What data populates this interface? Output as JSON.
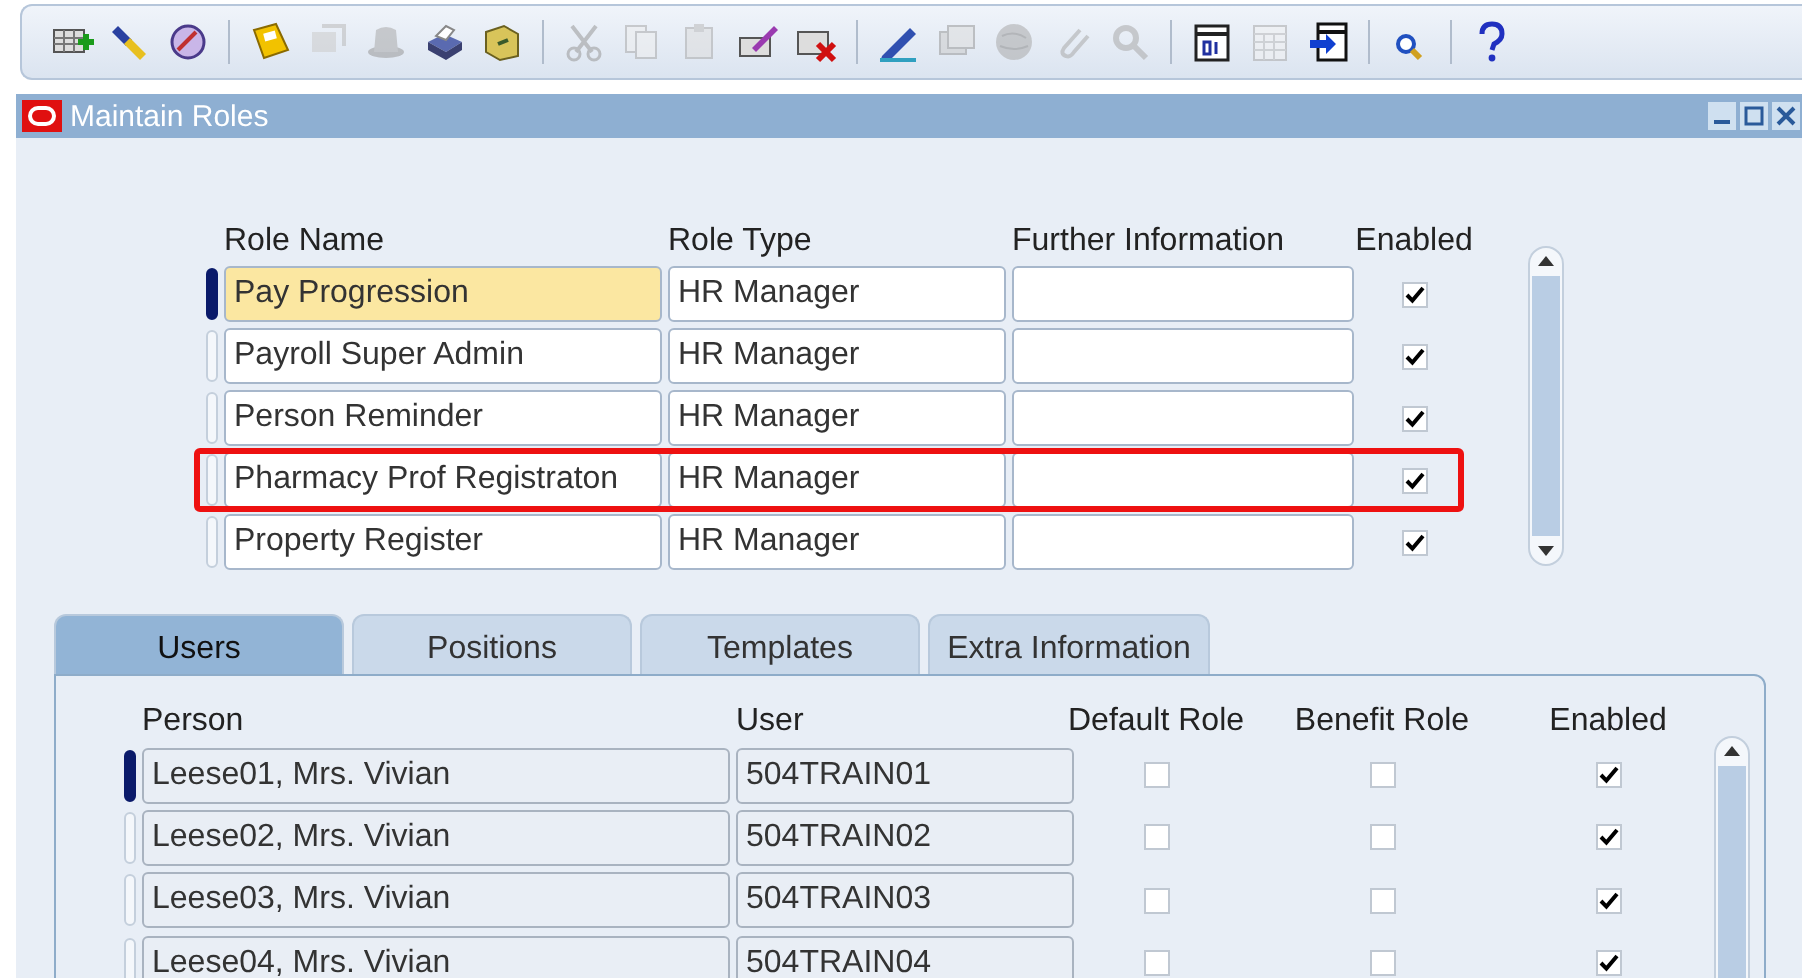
{
  "toolbar": [
    [
      {
        "kind": "new",
        "disabled": false
      },
      {
        "kind": "flashlight",
        "disabled": false
      },
      {
        "kind": "navigator",
        "disabled": false
      }
    ],
    [
      {
        "kind": "save",
        "disabled": false
      },
      {
        "kind": "next",
        "disabled": true
      },
      {
        "kind": "hat",
        "disabled": true
      },
      {
        "kind": "print",
        "disabled": false
      },
      {
        "kind": "folder",
        "disabled": false
      }
    ],
    [
      {
        "kind": "cut",
        "disabled": true
      },
      {
        "kind": "copy",
        "disabled": true
      },
      {
        "kind": "paste",
        "disabled": true
      },
      {
        "kind": "clear",
        "disabled": false
      },
      {
        "kind": "delete",
        "disabled": false
      }
    ],
    [
      {
        "kind": "edit",
        "disabled": false
      },
      {
        "kind": "zoom",
        "disabled": true
      },
      {
        "kind": "globe",
        "disabled": true
      },
      {
        "kind": "clip",
        "disabled": true
      },
      {
        "kind": "tools",
        "disabled": true
      }
    ],
    [
      {
        "kind": "calendar",
        "disabled": false
      },
      {
        "kind": "calendar2",
        "disabled": true
      },
      {
        "kind": "export",
        "disabled": false
      }
    ],
    [
      {
        "kind": "find",
        "disabled": false
      }
    ],
    [
      {
        "kind": "help",
        "disabled": false
      }
    ]
  ],
  "window": {
    "title": "Maintain Roles"
  },
  "roles": {
    "columns": [
      "Role Name",
      "Role Type",
      "Further Information",
      "Enabled"
    ],
    "rows": [
      {
        "role_name": "Pay Progression",
        "role_type": "HR Manager",
        "further_information": "",
        "enabled": true,
        "selected": true,
        "highlighted": false
      },
      {
        "role_name": "Payroll Super Admin",
        "role_type": "HR Manager",
        "further_information": "",
        "enabled": true,
        "selected": false,
        "highlighted": false
      },
      {
        "role_name": "Person Reminder",
        "role_type": "HR Manager",
        "further_information": "",
        "enabled": true,
        "selected": false,
        "highlighted": false
      },
      {
        "role_name": "Pharmacy Prof Registraton",
        "role_type": "HR Manager",
        "further_information": "",
        "enabled": true,
        "selected": false,
        "highlighted": true
      },
      {
        "role_name": "Property Register",
        "role_type": "HR Manager",
        "further_information": "",
        "enabled": true,
        "selected": false,
        "highlighted": false
      }
    ]
  },
  "tabs": [
    {
      "label": "Users",
      "selected": true
    },
    {
      "label": "Positions",
      "selected": false
    },
    {
      "label": "Templates",
      "selected": false
    },
    {
      "label": "Extra Information",
      "selected": false
    }
  ],
  "users": {
    "columns": [
      "Person",
      "User",
      "Default Role",
      "Benefit Role",
      "Enabled"
    ],
    "rows": [
      {
        "person": "Leese01, Mrs. Vivian",
        "user": "504TRAIN01",
        "default_role": false,
        "benefit_role": false,
        "enabled": true,
        "selected": true
      },
      {
        "person": "Leese02, Mrs. Vivian",
        "user": "504TRAIN02",
        "default_role": false,
        "benefit_role": false,
        "enabled": true,
        "selected": false
      },
      {
        "person": "Leese03, Mrs. Vivian",
        "user": "504TRAIN03",
        "default_role": false,
        "benefit_role": false,
        "enabled": true,
        "selected": false
      },
      {
        "person": "Leese04, Mrs. Vivian",
        "user": "504TRAIN04",
        "default_role": false,
        "benefit_role": false,
        "enabled": true,
        "selected": false
      }
    ]
  }
}
